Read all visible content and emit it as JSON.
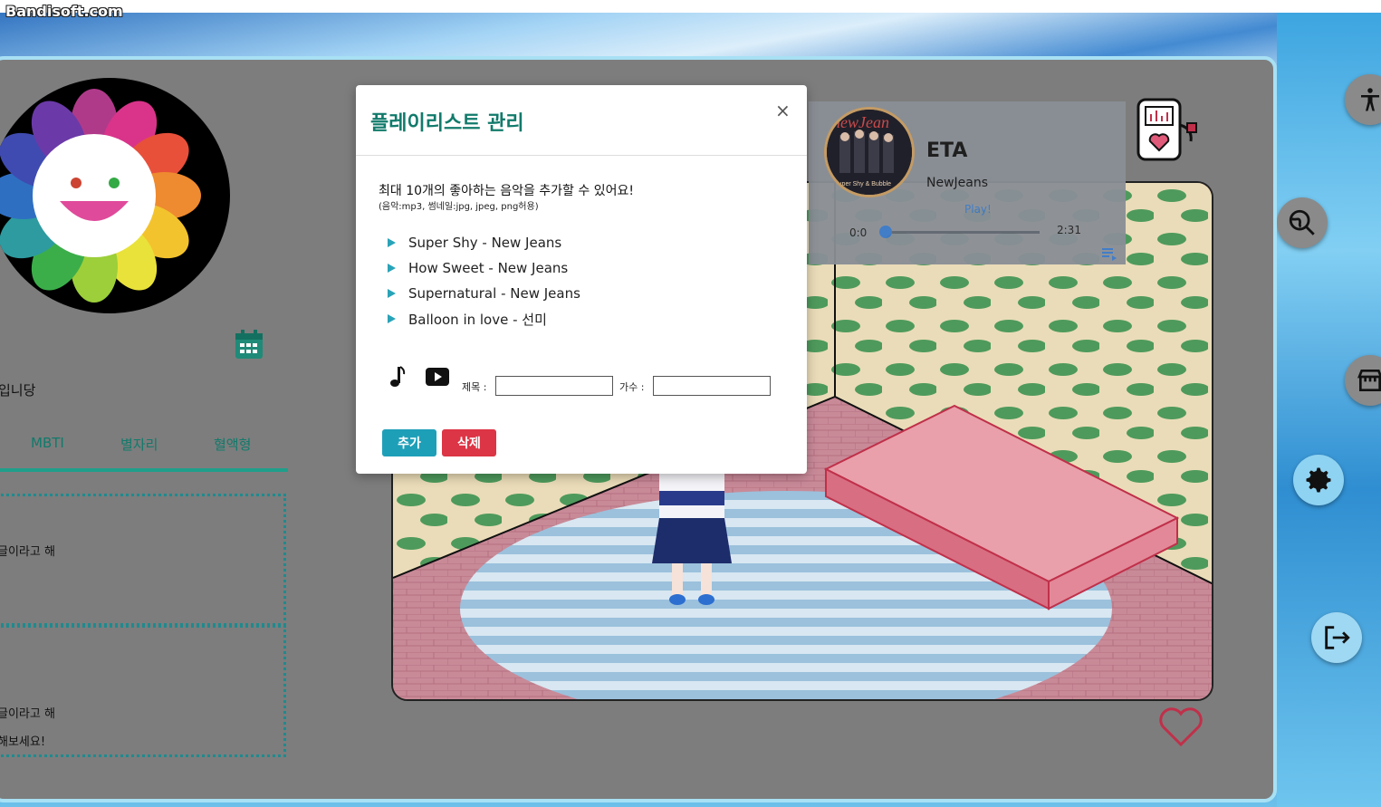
{
  "watermark": "Bandisoft.com",
  "profile": {
    "intro_text": "입니당",
    "tabs": [
      "MBTI",
      "별자리",
      "혈액형"
    ],
    "box1_text": "글이라고 해",
    "box2_text": "글이라고 해",
    "box2_subtext": "해보세요!"
  },
  "player": {
    "song_title": "ETA",
    "artist": "NewJeans",
    "play_label": "Play!",
    "current_time": "0:0",
    "duration": "2:31",
    "progress": 0.0
  },
  "modal": {
    "title": "플레이리스트 관리",
    "close": "×",
    "description": "최대 10개의 좋아하는 음악을 추가할 수 있어요!",
    "sub_description": "(음악:mp3, 썸네일:jpg, jpeg, png허용)",
    "playlist": [
      "Super Shy - New Jeans",
      "How Sweet - New Jeans",
      "Supernatural - New Jeans",
      "Balloon in love - 선미"
    ],
    "title_label": "제목 :",
    "artist_label": "가수 :",
    "title_value": "",
    "artist_value": "",
    "add_button": "추가",
    "delete_button": "삭제"
  },
  "colors": {
    "accent": "#117a6b",
    "add_button": "#1e9fb8",
    "delete_button": "#dc3545",
    "panel": "#7d7d7d"
  },
  "icons": [
    "calendar-icon",
    "music-player-icon",
    "heart-icon",
    "accessibility-icon",
    "search-globe-icon",
    "store-icon",
    "gear-icon",
    "logout-icon",
    "music-note-icon",
    "youtube-play-icon",
    "playlist-icon"
  ]
}
